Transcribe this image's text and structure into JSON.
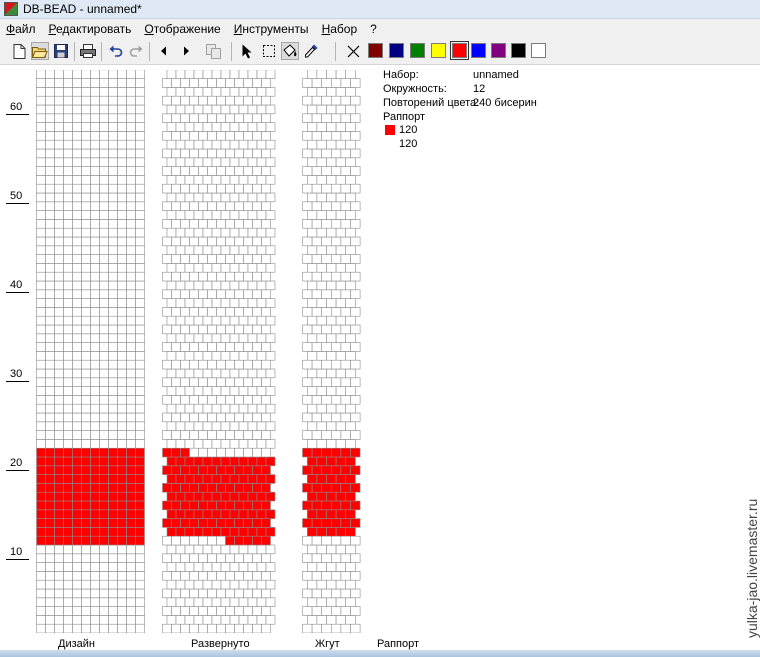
{
  "window": {
    "title": "DB-BEAD - unnamed*"
  },
  "menu": [
    "Файл",
    "Редактировать",
    "Отображение",
    "Инструменты",
    "Набор",
    "?"
  ],
  "toolbar": {
    "tools": [
      "new-file-icon",
      "open-folder-icon",
      "save-icon",
      "print-icon",
      "undo-icon",
      "redo-icon",
      "arrow-left-icon",
      "arrow-right-icon",
      "copy-icon",
      "pointer-icon",
      "select-rect-icon",
      "fill-icon",
      "eyedropper-icon",
      "clear-icon"
    ],
    "palette": [
      "#800000",
      "#000080",
      "#008000",
      "#ffff00",
      "#ff0000",
      "#0000ff",
      "#800080",
      "#000000",
      "#ffffff"
    ],
    "selected_color": "#ff0000"
  },
  "ruler": {
    "labels": [
      "60",
      "50",
      "40",
      "30",
      "20",
      "10"
    ]
  },
  "bead": {
    "fill_color": "#ff0000",
    "rows_from_bottom": 64,
    "design_columns": 12,
    "design_rows": {
      "from": 10,
      "to": 20
    }
  },
  "info": {
    "set_label": "Набор:",
    "set_value": "unnamed",
    "circumference_label": "Окружность:",
    "circumference_value": "12",
    "repeat_label": "Повторений цвета:",
    "repeat_value": "240 бисерин",
    "rapport_label": "Раппорт",
    "rapport_items": [
      {
        "color": "#ff0000",
        "count": "120"
      },
      {
        "color": "",
        "count": "120"
      }
    ]
  },
  "captions": {
    "design": "Дизайн",
    "unrolled": "Развернуто",
    "rope": "Жгут",
    "rapport": "Раппорт"
  },
  "watermark": "yulka-jao.livemaster.ru"
}
